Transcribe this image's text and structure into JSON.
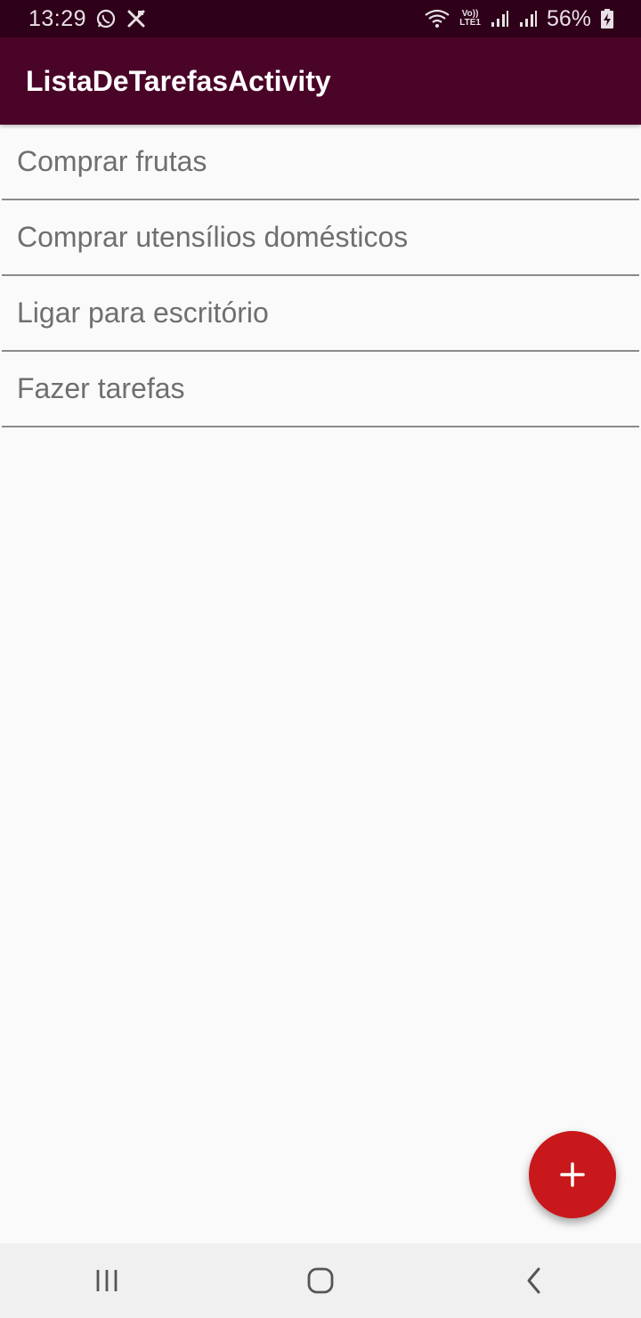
{
  "status_bar": {
    "time": "13:29",
    "battery_percent": "56%",
    "lte_label": "LTE1",
    "volte_label": "Vo))",
    "icons": [
      "whatsapp-icon",
      "mute-icon",
      "wifi-icon",
      "signal-icon",
      "signal-icon",
      "battery-charging-icon"
    ]
  },
  "app_bar": {
    "title": "ListaDeTarefasActivity",
    "color": "#4a0428"
  },
  "tasks": [
    {
      "label": "Comprar frutas"
    },
    {
      "label": "Comprar utensílios domésticos"
    },
    {
      "label": "Ligar para escritório"
    },
    {
      "label": "Fazer tarefas"
    }
  ],
  "fab": {
    "icon": "plus-icon",
    "color": "#c8181b"
  },
  "nav_bar": {
    "buttons": [
      "recent-apps-icon",
      "home-icon",
      "back-icon"
    ]
  }
}
